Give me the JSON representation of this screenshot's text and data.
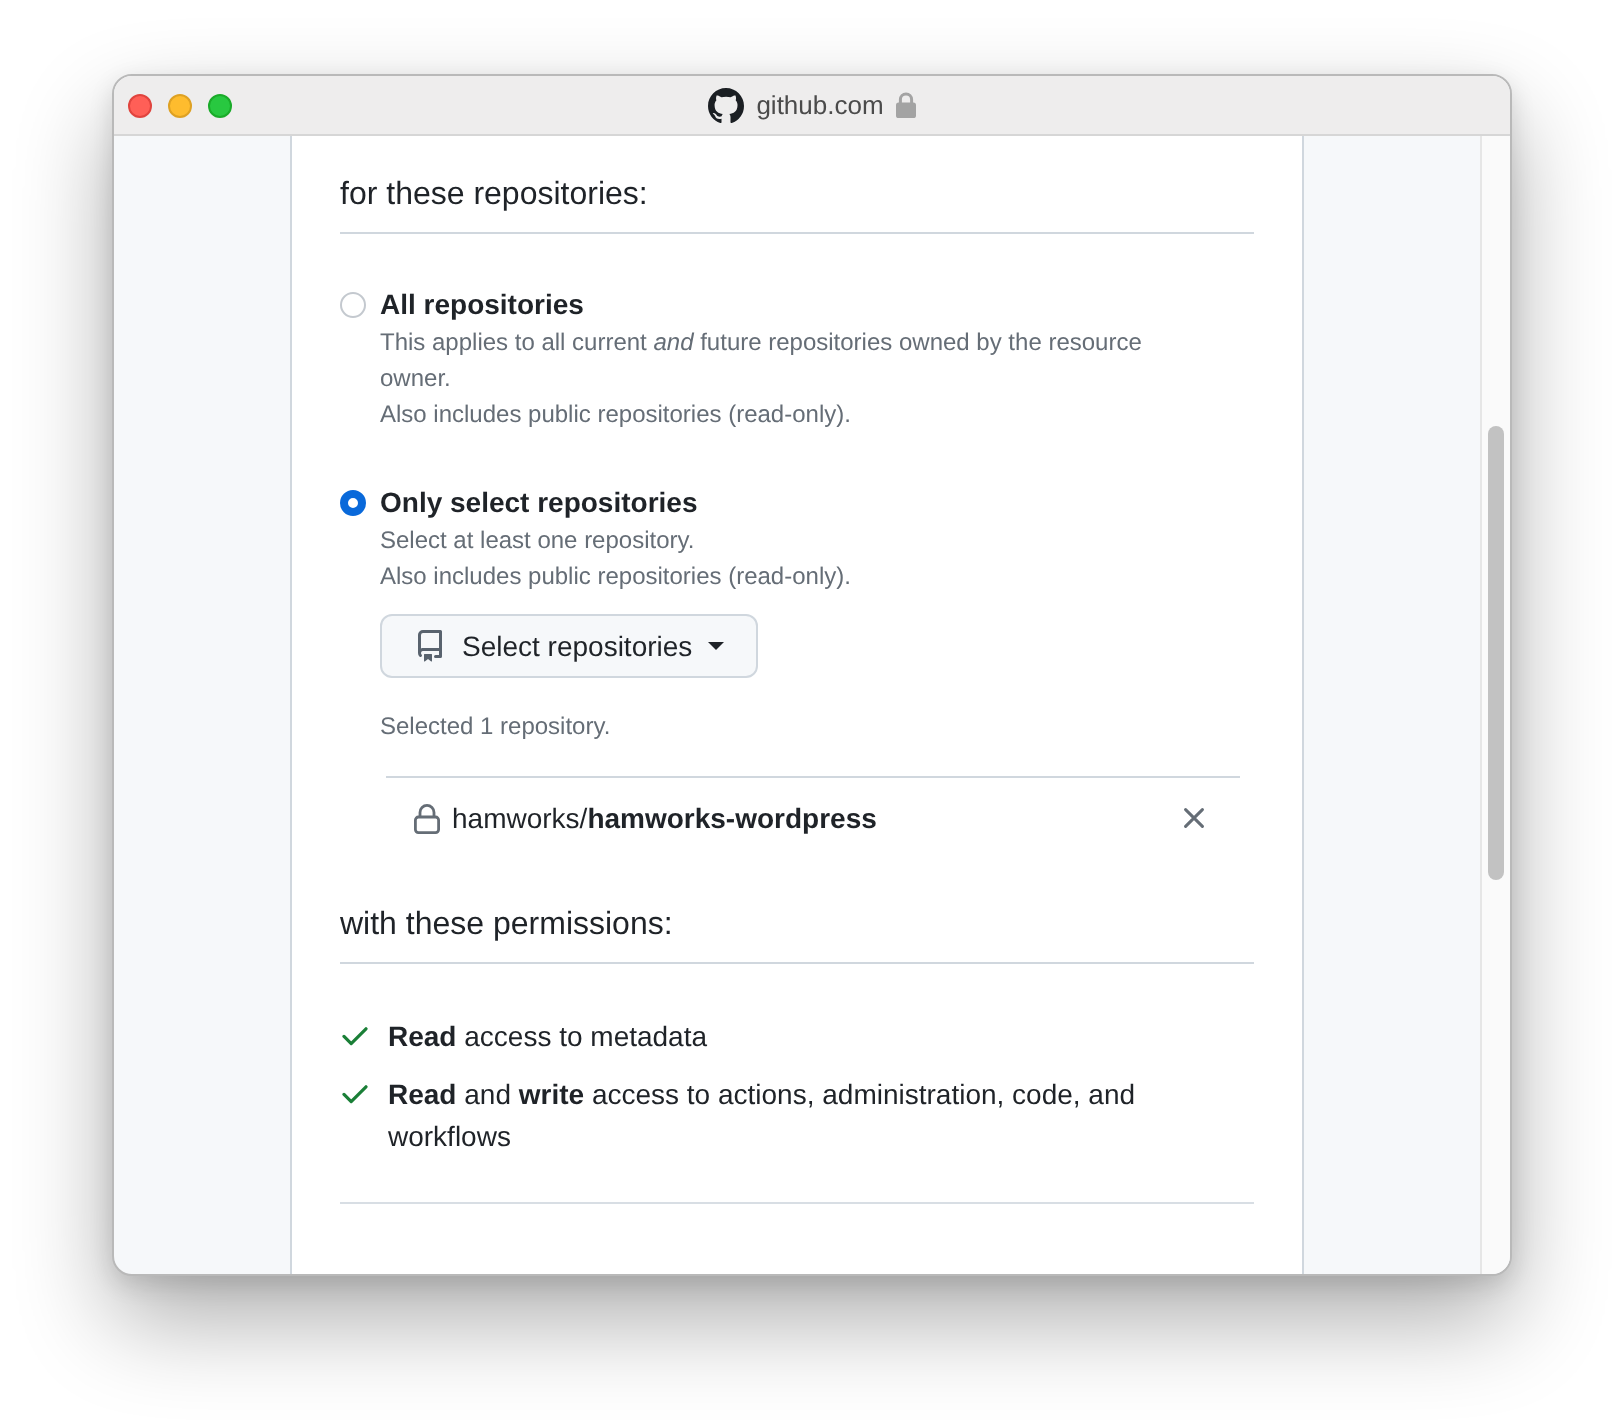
{
  "window": {
    "title": "github.com"
  },
  "repository_access": {
    "heading": "for these repositories:",
    "options": [
      {
        "label": "All repositories",
        "selected": false,
        "description": [
          "This applies to all current *and* future repositories owned by the resource owner.",
          "Also includes public repositories (read-only)."
        ]
      },
      {
        "label": "Only select repositories",
        "selected": true,
        "description": [
          "Select at least one repository.",
          "Also includes public repositories (read-only)."
        ],
        "button": {
          "label": "Select repositories"
        },
        "summary": "Selected 1 repository.",
        "repositories": [
          {
            "name": "hamworks/**hamworks-wordpress**"
          }
        ]
      }
    ]
  },
  "permissions": {
    "heading": "with these permissions:",
    "items": [
      {
        "text": "**Read** access to metadata"
      },
      {
        "text": "**Read** and **write** access to actions, administration, code, and workflows"
      }
    ]
  }
}
